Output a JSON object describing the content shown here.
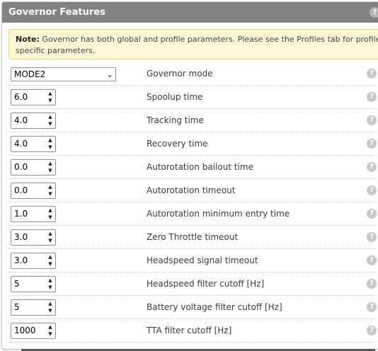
{
  "panel": {
    "title": "Governor Features",
    "help_glyph": "?"
  },
  "note": {
    "label": "Note:",
    "text": "Governor has both global and profile parameters. Please see the Profiles tab for profile specific parameters."
  },
  "governor_mode": {
    "value": "MODE2",
    "label": "Governor mode"
  },
  "spin_up_glyph": "▲",
  "spin_down_glyph": "▼",
  "select_arrow_glyph": "⌄",
  "fields": [
    {
      "value": "6.0",
      "label": "Spoolup time"
    },
    {
      "value": "4.0",
      "label": "Tracking time"
    },
    {
      "value": "4.0",
      "label": "Recovery time"
    },
    {
      "value": "0.0",
      "label": "Autorotation bailout time"
    },
    {
      "value": "0.0",
      "label": "Autorotation timeout"
    },
    {
      "value": "1.0",
      "label": "Autorotation minimum entry time"
    },
    {
      "value": "3.0",
      "label": "Zero Throttle timeout"
    },
    {
      "value": "3.0",
      "label": "Headspeed signal timeout"
    },
    {
      "value": "5",
      "label": "Headspeed filter cutoff [Hz]"
    },
    {
      "value": "5",
      "label": "Battery voltage filter cutoff [Hz]"
    },
    {
      "value": "1000",
      "label": "TTA filter cutoff [Hz]"
    }
  ],
  "colors": {
    "header_bg": "#828282",
    "note_bg": "#fdf7d6",
    "note_border": "#f3d27a",
    "help_icon": "#c8c8c8"
  }
}
